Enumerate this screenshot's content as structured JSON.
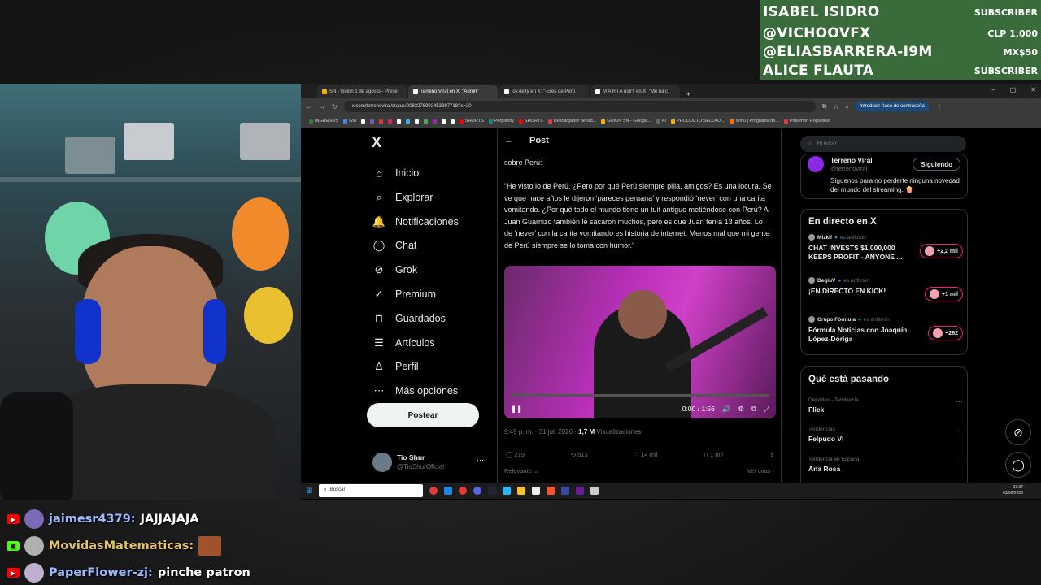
{
  "ticker": {
    "rows": [
      {
        "name": "ISABEL ISIDRO",
        "value": "SUBSCRIBER"
      },
      {
        "name": "@VICHOOVFX",
        "value": "CLP 1,000"
      },
      {
        "name": "@ELIASBARRERA-I9M",
        "value": "MX$50"
      },
      {
        "name": "ALICE FLAUTA",
        "value": "SUBSCRIBER"
      }
    ]
  },
  "browser": {
    "tabs": [
      {
        "title": "SN - Guion 1 de agosto - Prese",
        "color": "#f4b400"
      },
      {
        "title": "Terreno Viral en X: \"Auron\"",
        "color": "#ffffff"
      },
      {
        "title": "jov.4eity en X: \"-Eres de Perú",
        "color": "#ffffff"
      },
      {
        "title": "M A R I A noir† en X: \"Me fui c",
        "color": "#ffffff"
      }
    ],
    "new_tab": "+",
    "window_controls": [
      "–",
      "▢",
      "✕"
    ],
    "url": "x.com/terrenoviral/status/2083278902453997718?s=20",
    "password_button": "Introducir frase de contraseña",
    "bookmarks": [
      {
        "label": "INGRESOS",
        "color": "#2e7d32"
      },
      {
        "label": "GM",
        "color": "#4285f4"
      },
      {
        "label": "",
        "color": "#ffffff"
      },
      {
        "label": "",
        "color": "#7e57c2"
      },
      {
        "label": "",
        "color": "#e53935"
      },
      {
        "label": "",
        "color": "#e91e63"
      },
      {
        "label": "",
        "color": "#ffffff"
      },
      {
        "label": "",
        "color": "#29b6f6"
      },
      {
        "label": "",
        "color": "#ffffff"
      },
      {
        "label": "",
        "color": "#4caf50"
      },
      {
        "label": "",
        "color": "#9c27b0"
      },
      {
        "label": "",
        "color": "#ffffff"
      },
      {
        "label": "",
        "color": "#ffffff"
      },
      {
        "label": "SHORTS",
        "color": "#ff0000"
      },
      {
        "label": "Perplexity",
        "color": "#20808d"
      },
      {
        "label": "SHORTS",
        "color": "#ff0000"
      },
      {
        "label": "Descargador de víd...",
        "color": "#e53935"
      },
      {
        "label": "GUION SN - Google...",
        "color": "#f4b400"
      },
      {
        "label": "AI",
        "color": "#666666"
      },
      {
        "label": "PRODUCTO SELLAD...",
        "color": "#f4b400"
      },
      {
        "label": "Temu | Programa de...",
        "color": "#ff6f00"
      },
      {
        "label": "Pokemon Roguelike",
        "color": "#e53935"
      }
    ]
  },
  "x": {
    "logo": "X",
    "nav": [
      {
        "label": "Inicio",
        "icon": "⌂"
      },
      {
        "label": "Explorar",
        "icon": "⌕"
      },
      {
        "label": "Notificaciones",
        "icon": "🔔"
      },
      {
        "label": "Chat",
        "icon": "◯"
      },
      {
        "label": "Grok",
        "icon": "⊘"
      },
      {
        "label": "Premium",
        "icon": "✓"
      },
      {
        "label": "Guardados",
        "icon": "⊓"
      },
      {
        "label": "Artículos",
        "icon": "☰"
      },
      {
        "label": "Perfil",
        "icon": "♙"
      },
      {
        "label": "Más opciones",
        "icon": "⋯"
      }
    ],
    "post_button": "Postear",
    "profile_name": "Tio Shur",
    "profile_handle": "@TioShurOficial",
    "post_header": "Post",
    "post_text": "sobre Perú:\n\n“He visto lo de Perú. ¿Pero por qué Perú siempre pilla, amigos? Es una locura. Se ve que hace años le dijeron ‘pareces peruana’ y respondió ‘never’ con una carita vomitando. ¿Por qué todo el mundo tiene un tuit antiguo metiéndose con Perú? A Juan Guarnizo también le sacaron muchos, pero es que Juan tenía 13 años. Lo de ‘never’ con la carita vomitando es historia de internet. Menos mal que mi gente de Perú siempre se lo toma con humor.”",
    "video_time": "0:00 / 1:56",
    "video_progress": 0.0,
    "post_date": "9:49 p. m. · 31 jul. 2026 · ",
    "views_count": "1,7 M",
    "views_label": "Visualizaciones",
    "actions": {
      "replies": "219",
      "reposts": "513",
      "likes": "14 mil",
      "bookmarks": "1 mil"
    },
    "relevante": "Relevante",
    "ver_citas": "Ver citas",
    "search_placeholder": "Buscar",
    "follow_card": {
      "name": "Terreno Viral",
      "handle": "@terrenoviral",
      "button": "Siguiendo",
      "bio": "Síguenos para no perderte ninguna novedad del mundo del streaming. 🍿"
    },
    "live_title": "En directo en X",
    "live": [
      {
        "host": "Mizkif",
        "role": "es anfitrión",
        "title": "CHAT INVESTS $1,000,000 KEEPS PROFIT - ANYONE ...",
        "count": "+2,2 mil"
      },
      {
        "host": "DeqiuV",
        "role": "es anfitrión",
        "title": "¡EN DIRECTO EN KICK!",
        "count": "+1 mil"
      },
      {
        "host": "Grupo Fórmula",
        "role": "es anfitrión",
        "title": "Fórmula Noticias con Joaquín López-Dóriga",
        "count": "+262"
      }
    ],
    "trends_title": "Qué está pasando",
    "trends": [
      {
        "category": "Deportes · Tendencia",
        "name": "Flick"
      },
      {
        "category": "Tendencias",
        "name": "Felpudo VI"
      },
      {
        "category": "Tendencia en España",
        "name": "Ana Rosa"
      }
    ]
  },
  "taskbar": {
    "search": "Buscar",
    "time": "23:37",
    "date": "03/08/2026"
  },
  "chat": [
    {
      "platform": "youtube",
      "user": "jaimesr4379:",
      "message": "JAJJAJAJA",
      "user_color": "#9db8ff"
    },
    {
      "platform": "kick",
      "user": "MovidasMatematicas:",
      "message": "",
      "user_color": "#e6c36a"
    },
    {
      "platform": "youtube",
      "user": "PaperFlower-zj:",
      "message": "pinche patron",
      "user_color": "#9db8ff"
    }
  ]
}
